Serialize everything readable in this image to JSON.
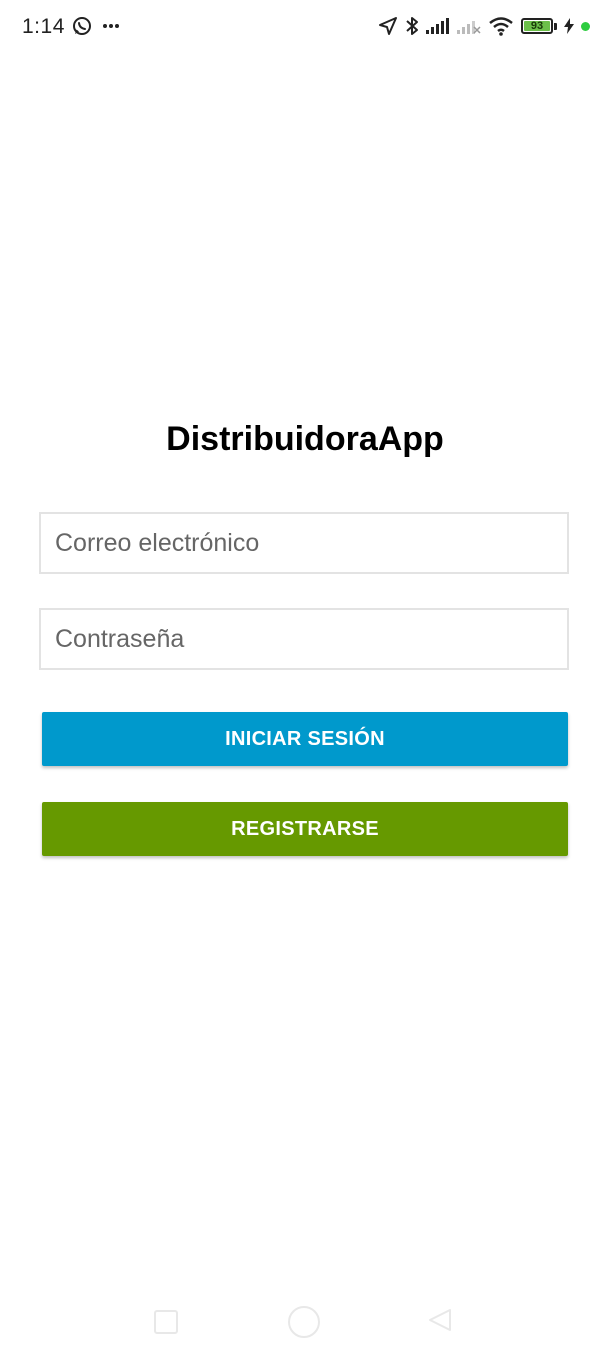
{
  "status_bar": {
    "time": "1:14",
    "notification_icons": [
      "whatsapp-icon",
      "more-dots-icon"
    ],
    "system_icons": [
      "location-icon",
      "bluetooth-icon",
      "signal-icon",
      "signal-weak-icon",
      "wifi-icon"
    ],
    "battery_level": "93",
    "battery_color": "#6cc04a",
    "charging": true
  },
  "app": {
    "title": "DistribuidoraApp"
  },
  "form": {
    "email_placeholder": "Correo electrónico",
    "email_value": "",
    "password_placeholder": "Contraseña",
    "password_value": ""
  },
  "buttons": {
    "login_label": "INICIAR SESIÓN",
    "login_color": "#0099cc",
    "register_label": "REGISTRARSE",
    "register_color": "#669900"
  },
  "nav_bar": {
    "items": [
      "recents-icon",
      "home-icon",
      "back-icon"
    ]
  }
}
